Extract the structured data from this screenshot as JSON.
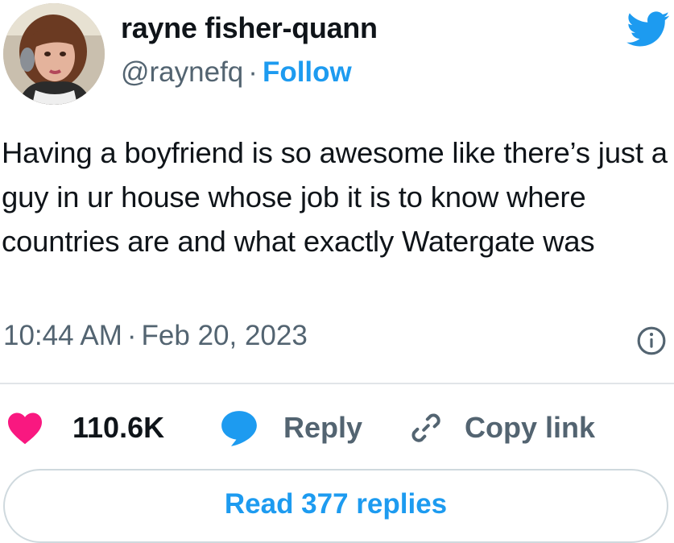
{
  "author": {
    "display_name": "rayne fisher-quann",
    "handle": "@raynefq",
    "separator": "·",
    "follow_label": "Follow"
  },
  "tweet": {
    "text": "Having a boyfriend is so awesome like there’s just a guy in ur house whose job it is to know where countries are and what exactly Watergate was",
    "time": "10:44 AM",
    "separator": "·",
    "date": "Feb 20, 2023"
  },
  "actions": {
    "like_count": "110.6K",
    "reply_label": "Reply",
    "copy_link_label": "Copy link"
  },
  "read_replies_label": "Read 377 replies",
  "icons": {
    "logo": "twitter-bird-icon",
    "info": "info-icon",
    "like": "heart-icon",
    "reply": "speech-bubble-icon",
    "copy": "link-icon"
  },
  "colors": {
    "accent": "#1d9bf0",
    "like": "#f91880",
    "text": "#0f1419",
    "secondary_text": "#536471",
    "border": "#cfd9de"
  }
}
